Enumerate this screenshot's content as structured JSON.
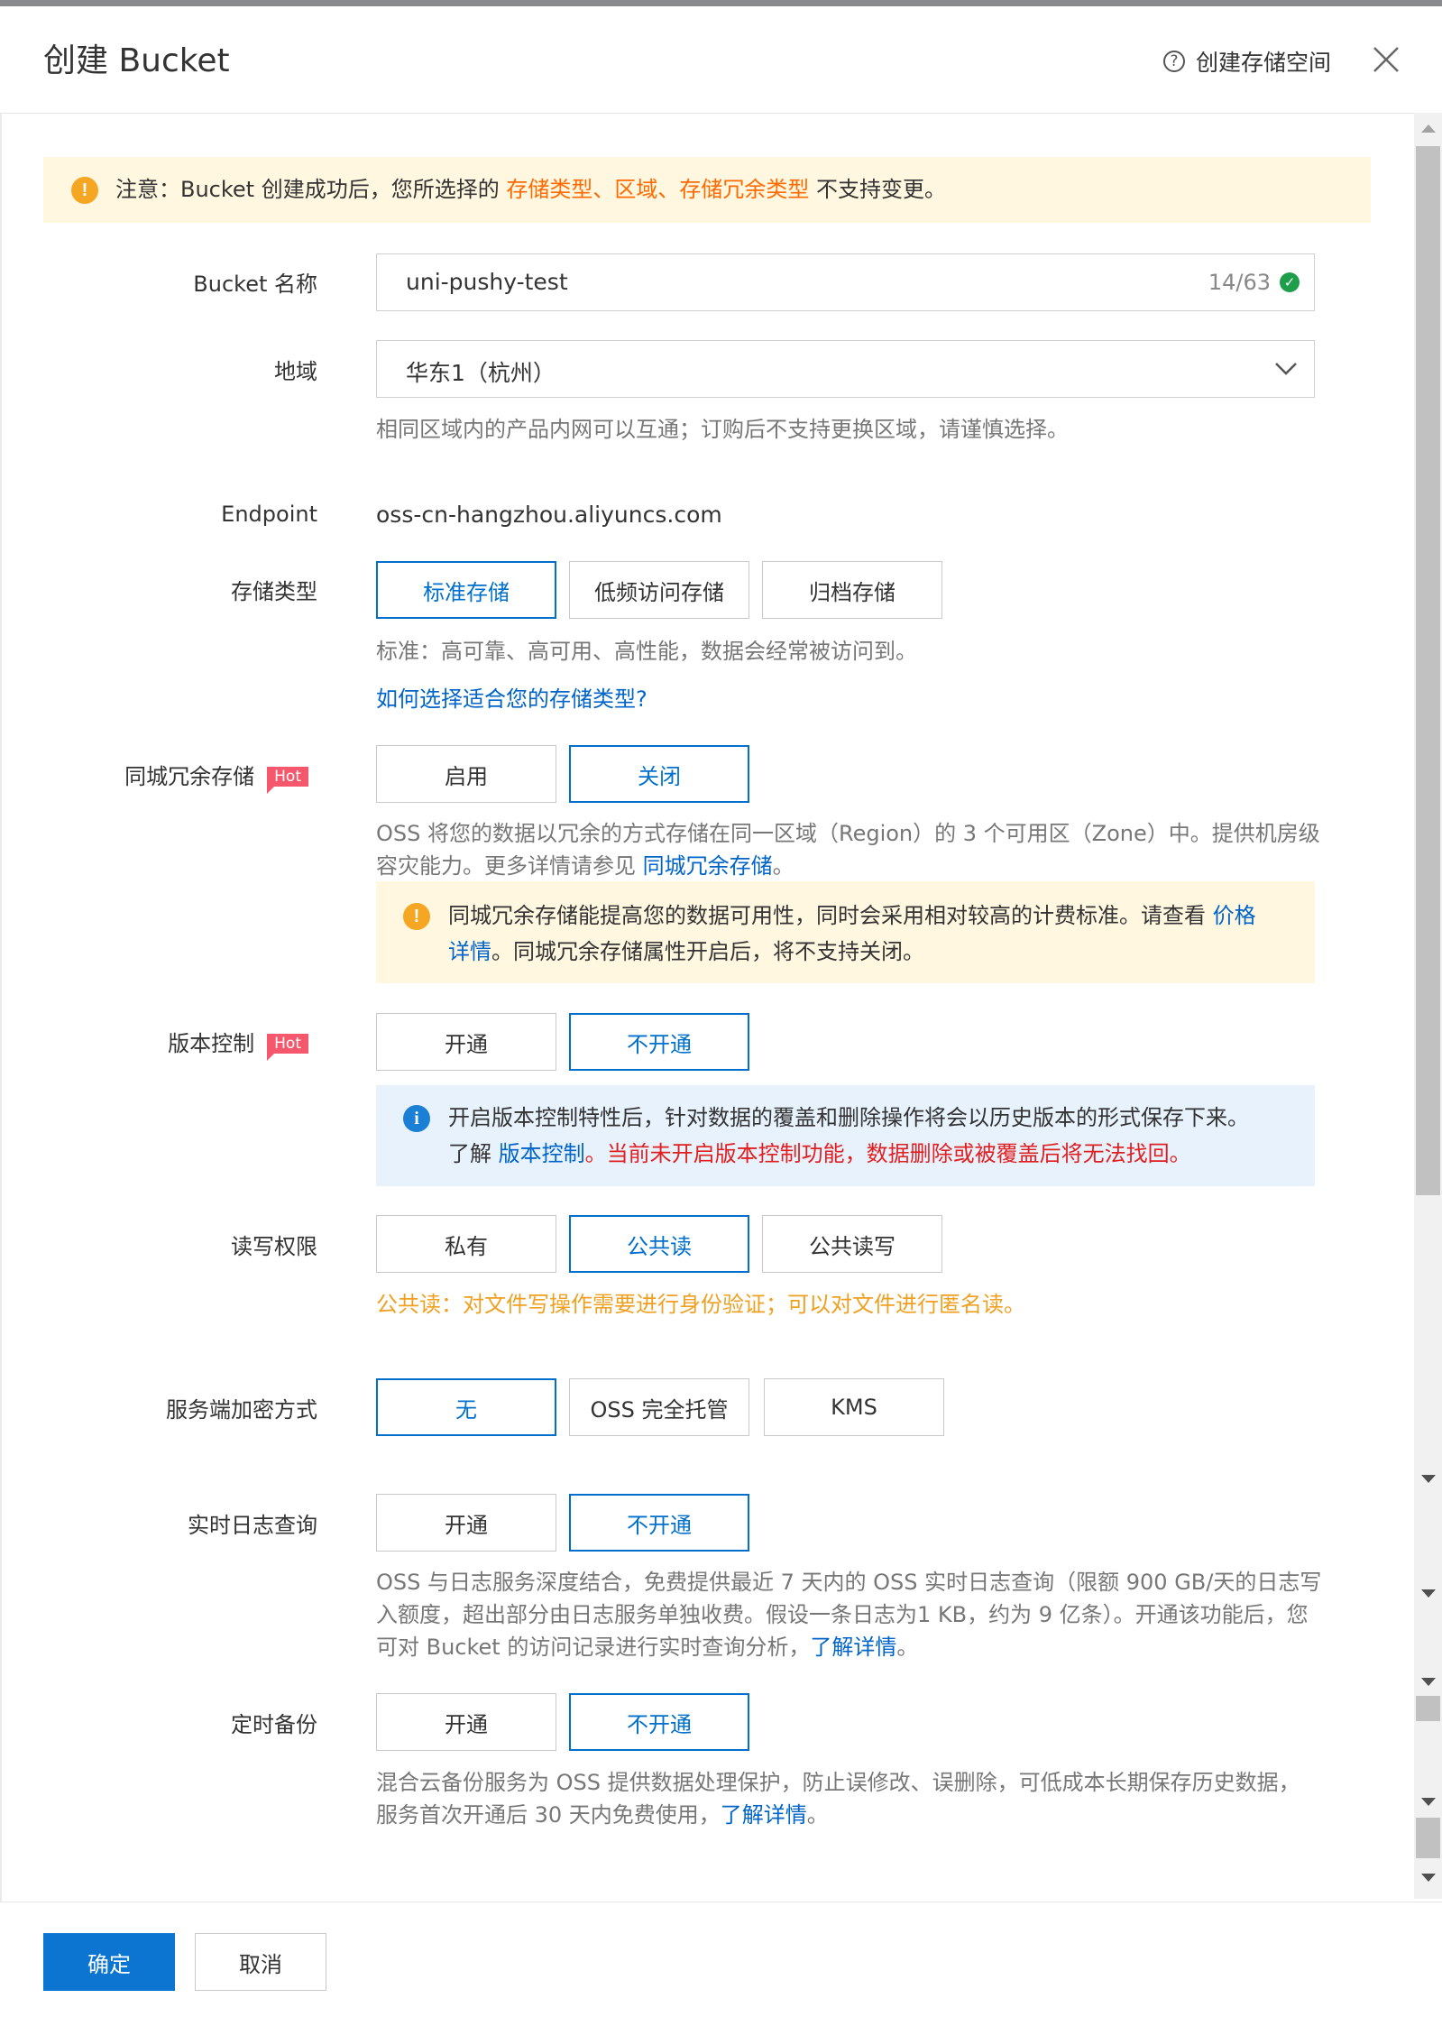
{
  "dialog": {
    "title": "创建 Bucket",
    "help_link": "创建存储空间"
  },
  "notice": {
    "prefix": "注意：Bucket 创建成功后，您所选择的 ",
    "hl1": "存储类型",
    "sep1": "、",
    "hl2": "区域",
    "sep2": "、",
    "hl3": "存储冗余类型",
    "suffix": " 不支持变更。"
  },
  "bucket_name": {
    "label": "Bucket 名称",
    "value": "uni-pushy-test",
    "counter": "14/63"
  },
  "region": {
    "label": "地域",
    "value": "华东1（杭州）",
    "help": "相同区域内的产品内网可以互通；订购后不支持更换区域，请谨慎选择。"
  },
  "endpoint": {
    "label": "Endpoint",
    "value": "oss-cn-hangzhou.aliyuncs.com"
  },
  "storage_class": {
    "label": "存储类型",
    "options": [
      "标准存储",
      "低频访问存储",
      "归档存储"
    ],
    "selected": "标准存储",
    "help": "标准：高可靠、高可用、高性能，数据会经常被访问到。",
    "link": "如何选择适合您的存储类型?"
  },
  "zrs": {
    "label": "同城冗余存储",
    "badge": "Hot",
    "options": [
      "启用",
      "关闭"
    ],
    "selected": "关闭",
    "help_line1": "OSS 将您的数据以冗余的方式存储在同一区域（Region）的 3 个可用区（Zone）中。提供机房级",
    "help_line2": "容灾能力。更多详情请参见 ",
    "help_link": "同城冗余存储",
    "help_end": "。",
    "warn_line1": "同城冗余存储能提高您的数据可用性，同时会采用相对较高的计费标准。请查看 ",
    "warn_link_a": "价格",
    "warn_link_b": "详情",
    "warn_line2": "。同城冗余存储属性开启后，将不支持关闭。"
  },
  "versioning": {
    "label": "版本控制",
    "badge": "Hot",
    "options": [
      "开通",
      "不开通"
    ],
    "selected": "不开通",
    "info_line1": "开启版本控制特性后，针对数据的覆盖和删除操作将会以历史版本的形式保存下来。",
    "info_pre": "了解 ",
    "info_link": "版本控制",
    "info_red": "。当前未开启版本控制功能，数据删除或被覆盖后将无法找回。"
  },
  "acl": {
    "label": "读写权限",
    "options": [
      "私有",
      "公共读",
      "公共读写"
    ],
    "selected": "公共读",
    "help": "公共读：对文件写操作需要进行身份验证；可以对文件进行匿名读。"
  },
  "encryption": {
    "label": "服务端加密方式",
    "options": [
      "无",
      "OSS 完全托管",
      "KMS"
    ],
    "selected": "无"
  },
  "realtime_log": {
    "label": "实时日志查询",
    "options": [
      "开通",
      "不开通"
    ],
    "selected": "不开通",
    "help_line1": "OSS 与日志服务深度结合，免费提供最近 7 天内的 OSS 实时日志查询（限额 900 GB/天的日志写",
    "help_line2": "入额度，超出部分由日志服务单独收费。假设一条日志为1 KB，约为 9 亿条）。开通该功能后，您",
    "help_line3": "可对 Bucket 的访问记录进行实时查询分析，",
    "help_link": "了解详情",
    "help_end": "。"
  },
  "backup": {
    "label": "定时备份",
    "options": [
      "开通",
      "不开通"
    ],
    "selected": "不开通",
    "help_line1": "混合云备份服务为 OSS 提供数据处理保护，防止误修改、误删除，可低成本长期保存历史数据，",
    "help_line2": "服务首次开通后 30 天内免费使用，",
    "help_link": "了解详情",
    "help_end": "。"
  },
  "footer": {
    "ok": "确定",
    "cancel": "取消"
  },
  "colors": {
    "primary": "#0b75d1",
    "link": "#0064c8",
    "warning": "#ff6a00",
    "danger": "#e02020",
    "hot_badge": "#f5576c"
  }
}
